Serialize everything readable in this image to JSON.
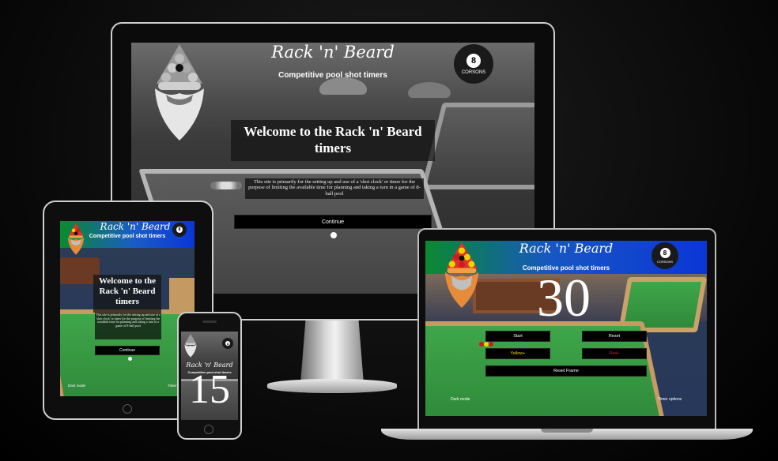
{
  "site": {
    "title": "Rack 'n' Beard",
    "subtitle": "Competitive pool shot timers",
    "badge_number": "8",
    "badge_text": "CORSONS"
  },
  "landing": {
    "welcome": "Welcome to the Rack 'n' Beard timers",
    "description": "This site is primarily for the setting up and use of a 'shot clock' or timer for the purpose of limiting the available time for planning and taking a turn in a game of 8-ball pool",
    "continue_button": "Continue"
  },
  "tablet_footer": {
    "dark_mode": "Dark mode",
    "timer_options": "Timer"
  },
  "timer": {
    "value": "30",
    "start_button": "Start",
    "reset_button": "Reset",
    "yellow_button": "Yellow+",
    "red_button": "Red+",
    "reset_frame_button": "Reset Frame",
    "dark_mode": "Dark mode",
    "timer_options": "Timer options"
  },
  "phone": {
    "timer_value": "15"
  },
  "colors": {
    "header_blue": "#0b36d6",
    "header_green": "#0a8a2e",
    "felt_green": "#3aa246",
    "button_black": "#000000",
    "yellow_text": "#f2d500",
    "red_text": "#d11a1a"
  }
}
